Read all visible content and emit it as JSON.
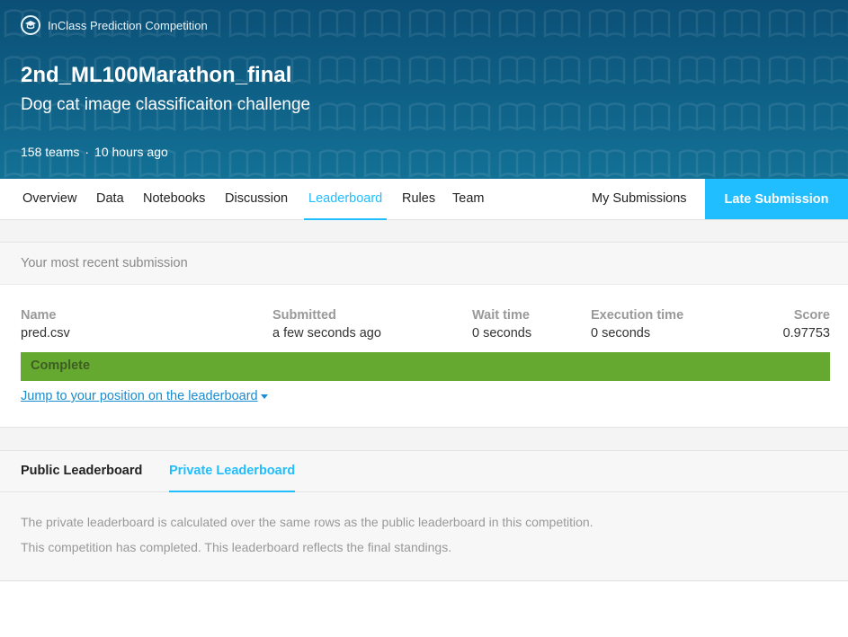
{
  "header": {
    "badge_label": "InClass Prediction Competition",
    "badge_icon": "graduation-cap-icon",
    "title": "2nd_ML100Marathon_final",
    "subtitle": "Dog cat image classificaiton challenge",
    "teams": "158 teams",
    "separator": "·",
    "time": "10 hours ago"
  },
  "nav": {
    "tabs": [
      {
        "label": "Overview",
        "active": false
      },
      {
        "label": "Data",
        "active": false
      },
      {
        "label": "Notebooks",
        "active": false
      },
      {
        "label": "Discussion",
        "active": false
      },
      {
        "label": "Leaderboard",
        "active": true
      },
      {
        "label": "Rules",
        "active": false
      },
      {
        "label": "Team",
        "active": false
      }
    ],
    "my_submissions": "My Submissions",
    "late_submission": "Late Submission"
  },
  "recent_submission": {
    "heading": "Your most recent submission",
    "columns": {
      "name": {
        "label": "Name",
        "value": "pred.csv"
      },
      "submitted": {
        "label": "Submitted",
        "value": "a few seconds ago"
      },
      "wait_time": {
        "label": "Wait time",
        "value": "0 seconds"
      },
      "execution_time": {
        "label": "Execution time",
        "value": "0 seconds"
      },
      "score": {
        "label": "Score",
        "value": "0.97753"
      }
    },
    "status": "Complete",
    "jump_link": "Jump to your position on the leaderboard"
  },
  "leaderboard": {
    "tabs": [
      "Public Leaderboard",
      "Private Leaderboard"
    ],
    "active_tab": "Private Leaderboard",
    "notes": [
      "The private leaderboard is calculated over the same rows as the public leaderboard in this competition.",
      "This competition has completed. This leaderboard reflects the final standings."
    ]
  },
  "colors": {
    "accent": "#20beff",
    "banner": "#0f6187",
    "status_complete": "#66a930",
    "link": "#1a8cd0"
  }
}
